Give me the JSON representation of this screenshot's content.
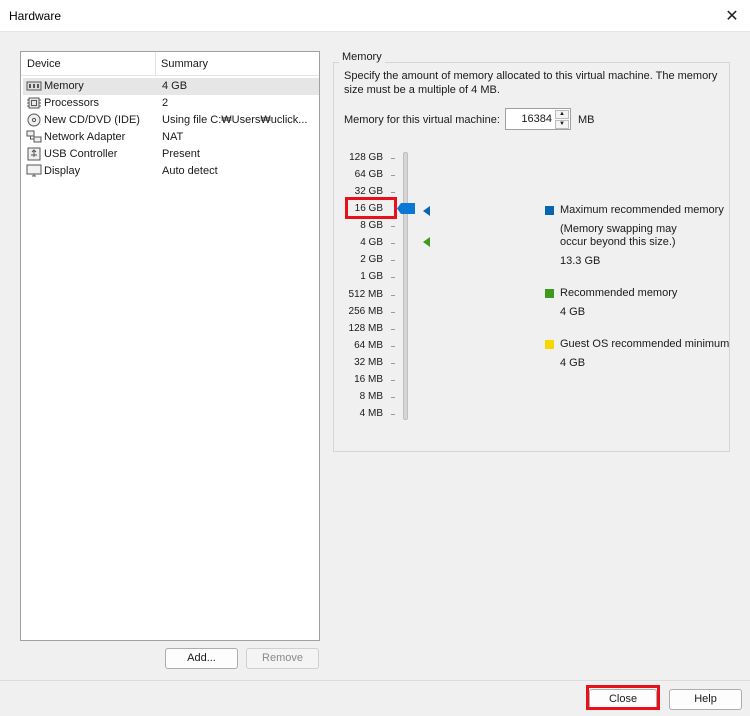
{
  "window": {
    "title": "Hardware"
  },
  "device_list": {
    "columns": [
      "Device",
      "Summary"
    ],
    "rows": [
      {
        "icon": "memory-icon",
        "device": "Memory",
        "summary": "4 GB",
        "selected": true
      },
      {
        "icon": "processor-icon",
        "device": "Processors",
        "summary": "2"
      },
      {
        "icon": "cd-dvd-icon",
        "device": "New CD/DVD (IDE)",
        "summary": "Using file C:₩Users₩uclick..."
      },
      {
        "icon": "network-icon",
        "device": "Network Adapter",
        "summary": "NAT"
      },
      {
        "icon": "usb-icon",
        "device": "USB Controller",
        "summary": "Present"
      },
      {
        "icon": "display-icon",
        "device": "Display",
        "summary": "Auto detect"
      }
    ],
    "add_label": "Add...",
    "remove_label": "Remove"
  },
  "memory": {
    "group_title": "Memory",
    "description": "Specify the amount of memory allocated to this virtual machine. The memory size must be a multiple of 4 MB.",
    "field_label": "Memory for this virtual machine:",
    "field_value": "16384",
    "unit": "MB",
    "scale": [
      "128 GB",
      "64 GB",
      "32 GB",
      "16 GB",
      "8 GB",
      "4 GB",
      "2 GB",
      "1 GB",
      "512 MB",
      "256 MB",
      "128 MB",
      "64 MB",
      "32 MB",
      "16 MB",
      "8 MB",
      "4 MB"
    ],
    "slider_value": "16 GB",
    "legend": {
      "max_title": "Maximum recommended memory",
      "max_note": "(Memory swapping may occur beyond this size.)",
      "max_value": "13.3 GB",
      "rec_title": "Recommended memory",
      "rec_value": "4 GB",
      "min_title": "Guest OS recommended minimum",
      "min_value": "4 GB"
    },
    "colors": {
      "max": "#0a64b4",
      "recommended": "#3e9a1a",
      "minimum": "#f5d800"
    }
  },
  "footer": {
    "close_label": "Close",
    "help_label": "Help"
  },
  "highlight_color": "#e8101a"
}
